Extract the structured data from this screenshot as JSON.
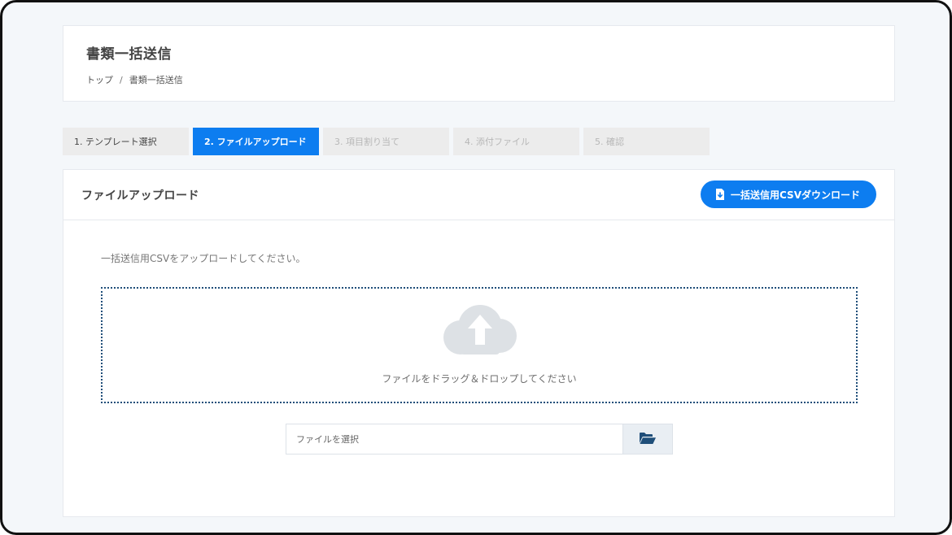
{
  "header": {
    "title": "書類一括送信",
    "breadcrumb": {
      "home": "トップ",
      "separator": "/",
      "current": "書類一括送信"
    }
  },
  "steps": [
    {
      "label": "1. テンプレート選択",
      "state": "done"
    },
    {
      "label": "2. ファイルアップロード",
      "state": "active"
    },
    {
      "label": "3. 項目割り当て",
      "state": "pending"
    },
    {
      "label": "4. 添付ファイル",
      "state": "pending"
    },
    {
      "label": "5. 確認",
      "state": "pending"
    }
  ],
  "card": {
    "title": "ファイルアップロード",
    "download_button": {
      "label": "一括送信用CSVダウンロード",
      "icon": "file-download-icon"
    },
    "instruction": "一括送信用CSVをアップロードしてください。",
    "dropzone": {
      "icon": "cloud-upload-icon",
      "text": "ファイルをドラッグ＆ドロップしてください"
    },
    "file_input": {
      "placeholder": "ファイルを選択",
      "value": "",
      "browse_icon": "folder-open-icon"
    }
  },
  "colors": {
    "accent": "#0d7df0",
    "background": "#f4f7fa",
    "step_inactive": "#ececec",
    "dropzone_border": "#1f4e79",
    "cloud": "#dde1e5",
    "folder_icon": "#1f4e79"
  }
}
